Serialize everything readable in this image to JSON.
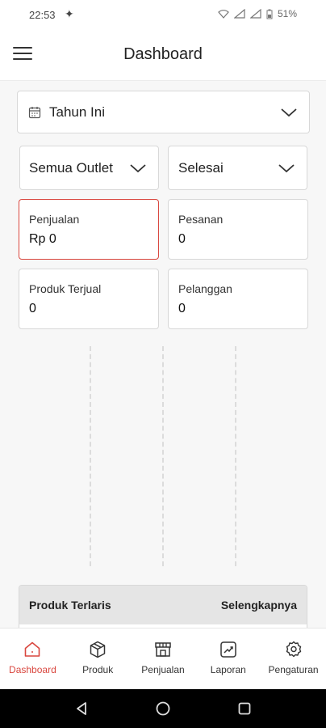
{
  "status_bar": {
    "time": "22:53",
    "battery": "51%"
  },
  "app_bar": {
    "title": "Dashboard"
  },
  "filters": {
    "period": "Tahun Ini",
    "outlet": "Semua Outlet",
    "status": "Selesai"
  },
  "stats": [
    {
      "label": "Penjualan",
      "value": "Rp 0"
    },
    {
      "label": "Pesanan",
      "value": "0"
    },
    {
      "label": "Produk Terjual",
      "value": "0"
    },
    {
      "label": "Pelanggan",
      "value": "0"
    }
  ],
  "best_products": {
    "title": "Produk Terlaris",
    "link": "Selengkapnya"
  },
  "bottom_nav": [
    {
      "label": "Dashboard",
      "icon": "home-icon",
      "active": true
    },
    {
      "label": "Produk",
      "icon": "box-icon",
      "active": false
    },
    {
      "label": "Penjualan",
      "icon": "store-icon",
      "active": false
    },
    {
      "label": "Laporan",
      "icon": "report-chart-icon",
      "active": false
    },
    {
      "label": "Pengaturan",
      "icon": "gear-icon",
      "active": false
    }
  ],
  "colors": {
    "accent": "#d9473f",
    "header_bg": "#e5e5e5"
  }
}
